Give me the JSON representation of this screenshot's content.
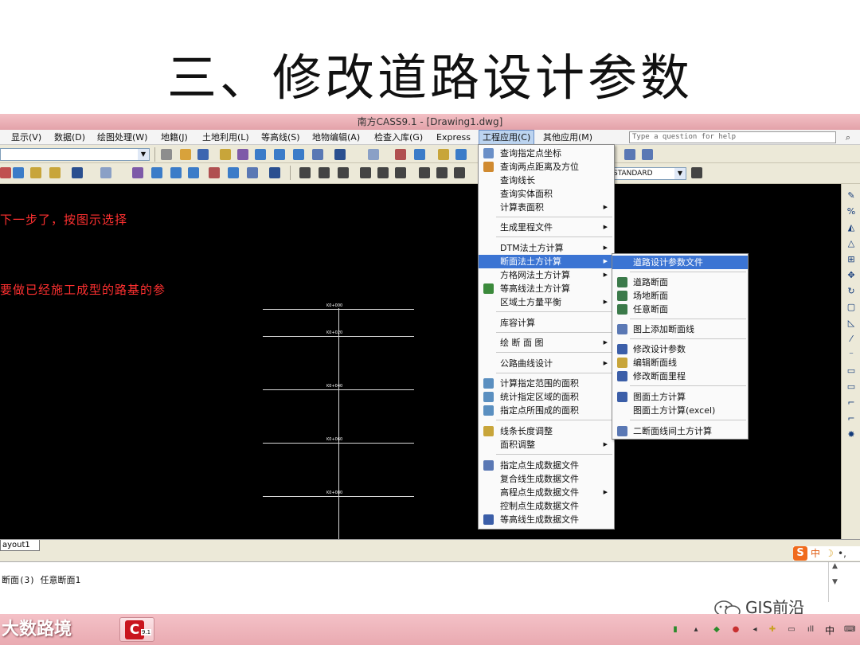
{
  "slide": {
    "title": "三、修改道路设计参数"
  },
  "window": {
    "title": "南方CASS9.1 - [Drawing1.dwg]"
  },
  "menubar": {
    "items": [
      {
        "label": "显示(V)"
      },
      {
        "label": "数据(D)"
      },
      {
        "label": "绘图处理(W)"
      },
      {
        "label": "地籍(J)"
      },
      {
        "label": "土地利用(L)"
      },
      {
        "label": "等高线(S)"
      },
      {
        "label": "地物编辑(A)"
      },
      {
        "label": "检查入库(G)"
      },
      {
        "label": "Express"
      },
      {
        "label": "工程应用(C)"
      },
      {
        "label": "其他应用(M)"
      }
    ],
    "active": "工程应用(C)",
    "help_placeholder": "Type a question for help"
  },
  "toolbar": {
    "style_combo": "STANDARD"
  },
  "canvas": {
    "notes": [
      "下一步了，按图示选择",
      "要做已经施工成型的路基的参"
    ],
    "stations": [
      "K0+000",
      "K0+020",
      "K0+040",
      "K0+060",
      "K0+080"
    ]
  },
  "layout_tab": "ayout1",
  "command_line": "断面(3) 任意断面1",
  "main_menu": {
    "items": [
      {
        "label": "查询指定点坐标",
        "icon": "query-point-icon"
      },
      {
        "label": "查询两点距离及方位",
        "icon": "distance-icon"
      },
      {
        "label": "查询线长"
      },
      {
        "label": "查询实体面积"
      },
      {
        "label": "计算表面积",
        "submenu": true
      },
      {
        "label": "生成里程文件",
        "submenu": true
      },
      {
        "label": "DTM法土方计算",
        "submenu": true
      },
      {
        "label": "断面法土方计算",
        "submenu": true,
        "highlighted": true
      },
      {
        "label": "方格网法土方计算",
        "submenu": true
      },
      {
        "label": "等高线法土方计算",
        "icon": "contour-volume-icon"
      },
      {
        "label": "区域土方量平衡",
        "submenu": true
      },
      {
        "label": "库容计算"
      },
      {
        "label": "绘 断 面 图",
        "submenu": true
      },
      {
        "label": "公路曲线设计",
        "submenu": true
      },
      {
        "label": "计算指定范围的面积",
        "icon": "area-range-icon"
      },
      {
        "label": "统计指定区域的面积",
        "icon": "area-stat-icon"
      },
      {
        "label": "指定点所围成的面积",
        "icon": "area-points-icon"
      },
      {
        "label": "线条长度调整",
        "icon": "line-length-icon"
      },
      {
        "label": "面积调整",
        "submenu": true
      },
      {
        "label": "指定点生成数据文件",
        "icon": "data-file-icon"
      },
      {
        "label": "复合线生成数据文件"
      },
      {
        "label": "高程点生成数据文件",
        "submenu": true
      },
      {
        "label": "控制点生成数据文件"
      },
      {
        "label": "等高线生成数据文件",
        "icon": "contour-data-icon"
      }
    ]
  },
  "sub_menu": {
    "items": [
      {
        "label": "道路设计参数文件",
        "highlighted": true
      },
      {
        "label": "道路断面",
        "icon": "road-section-icon"
      },
      {
        "label": "场地断面",
        "icon": "site-section-icon"
      },
      {
        "label": "任意断面",
        "icon": "any-section-icon"
      },
      {
        "label": "图上添加断面线",
        "icon": "add-section-line-icon"
      },
      {
        "label": "修改设计参数",
        "icon": "edit-params-icon"
      },
      {
        "label": "编辑断面线",
        "icon": "edit-section-line-icon"
      },
      {
        "label": "修改断面里程",
        "icon": "edit-mileage-icon"
      },
      {
        "label": "图面土方计算",
        "icon": "drawing-volume-icon"
      },
      {
        "label": "图面土方计算(excel)"
      },
      {
        "label": "二断面线间土方计算",
        "icon": "two-section-volume-icon"
      }
    ]
  },
  "taskbar": {
    "app_logo": "大数路境",
    "cass_version": "9.1",
    "ime": "中",
    "tray_lang": "中"
  },
  "watermark": "GIS前沿",
  "colors": {
    "titlebar": "#e3a2a9",
    "canvas_bg": "#000000",
    "note_text": "#ff3030",
    "menu_highlight": "#3b74d3"
  }
}
